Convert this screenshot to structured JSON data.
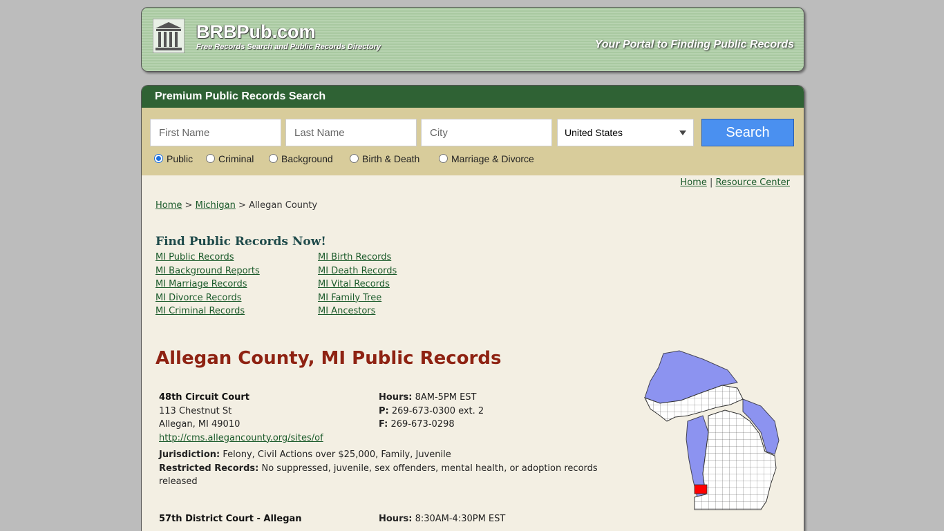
{
  "header": {
    "site_name": "BRBPub.com",
    "tagline": "Free Records Search and Public Records Directory",
    "portal_text": "Your Portal to Finding Public Records"
  },
  "search": {
    "title": "Premium Public Records Search",
    "first_placeholder": "First Name",
    "last_placeholder": "Last Name",
    "city_placeholder": "City",
    "country": "United States",
    "button": "Search",
    "radios": [
      "Public",
      "Criminal",
      "Background",
      "Birth & Death",
      "Marriage & Divorce"
    ],
    "selected": "Public"
  },
  "toplinks": {
    "home": "Home",
    "sep": "|",
    "resource": "Resource Center"
  },
  "breadcrumb": {
    "home": "Home",
    "sep1": ">",
    "state": "Michigan",
    "sep2": ">",
    "current": "Allegan County"
  },
  "find": {
    "title": "Find Public Records Now!",
    "col1": [
      "MI Public Records",
      "MI Background Reports",
      "MI Marriage Records",
      "MI Divorce Records",
      "MI Criminal Records"
    ],
    "col2": [
      "MI Birth Records",
      "MI Death Records",
      "MI Vital Records",
      "MI Family Tree",
      "MI Ancestors"
    ]
  },
  "county_title": "Allegan County, MI Public Records",
  "records": [
    {
      "name": "48th Circuit Court",
      "street": "113 Chestnut St",
      "city": "Allegan, MI 49010",
      "url": "http://cms.allegancounty.org/sites/of",
      "hours_label": "Hours:",
      "hours": "8AM-5PM EST",
      "phone_label": "P:",
      "phone": "269-673-0300 ext. 2",
      "fax_label": "F:",
      "fax": "269-673-0298",
      "jurisdiction_label": "Jurisdiction:",
      "jurisdiction": "Felony, Civil Actions over $25,000, Family, Juvenile",
      "restricted_label": "Restricted Records:",
      "restricted": "No suppressed, juvenile, sex offenders, mental health, or adoption records released"
    },
    {
      "name": "57th District Court - Allegan",
      "hours_label": "Hours:",
      "hours": "8:30AM-4:30PM EST"
    }
  ],
  "colors": {
    "header_green": "#2f6234",
    "title_red": "#8e2212",
    "search_blue": "#4a90f0",
    "lake_blue": "#8c93f0",
    "county_highlight": "#ff0000"
  }
}
